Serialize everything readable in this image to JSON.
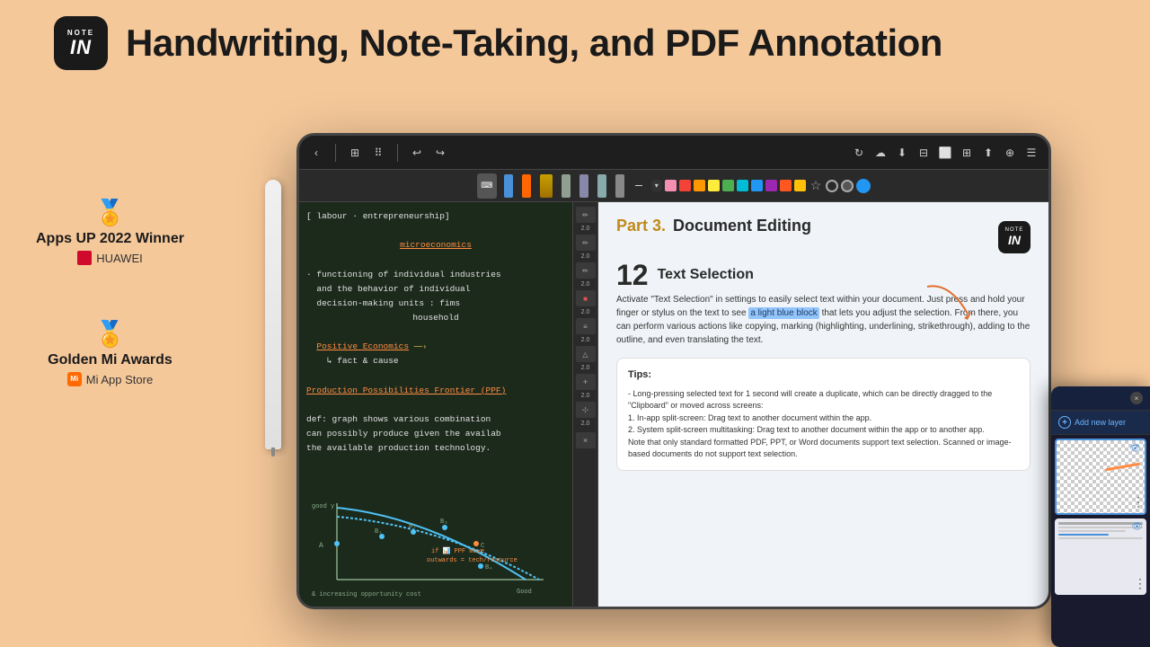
{
  "header": {
    "logo_note": "NOTE",
    "logo_in": "IN",
    "title": "Handwriting, Note-Taking, and PDF Annotation"
  },
  "awards": [
    {
      "id": "apps_up",
      "title": "Apps UP 2022 Winner",
      "brand": "HUAWEI"
    },
    {
      "id": "golden_mi",
      "title": "Golden Mi Awards",
      "brand": "Mi App Store"
    }
  ],
  "tablet": {
    "toolbar_icons": [
      "←",
      "☰",
      "⊞",
      "↩",
      "↪"
    ],
    "toolbar_right_icons": [
      "↻",
      "☁",
      "⬇",
      "⊟",
      "⬜",
      "⊞",
      "⬆",
      "⊕",
      "☰"
    ]
  },
  "note_panel": {
    "lines": [
      "[ labour · entrepreneurship]",
      "",
      "microeconomics",
      "",
      "· functioning of individual industries",
      "  and the behavior of individual",
      "  decision-making units : fims",
      "  household",
      "",
      "Positive Economics",
      "↳ fact & cause",
      "",
      "Production Possibilities Frontier (PPF)",
      "",
      "def: graph shows various combination",
      "can possibly produce given the availab",
      "the available production technology.",
      "",
      "& increasing opportunity cost"
    ]
  },
  "doc_panel": {
    "part_label": "Part 3.",
    "part_title": "Document Editing",
    "section_num": "12",
    "section_title": "Text Selection",
    "body_text": "Activate \"Text Selection\" in settings to easily select text within your document. Just press and hold your finger or stylus on the text to see",
    "highlight_text": "a light blue block",
    "body_text2": "that lets you adjust the selection. From there, you can perform various actions like copying, marking (highlighting, underlining, strikethrough), adding to the outline, and even translating the text.",
    "tips_title": "Tips:",
    "tips_lines": [
      "- Long-pressing selected text for 1 second will create a duplicate, which can be directly dragged to the \"Clipboard\" or moved across screens:",
      "1. In-app split-screen: Drag text to another document within the app.",
      "2. System split-screen multitasking: Drag text to another document within the app or to another app.",
      "Note that only standard formatted PDF, PPT, or Word documents support text selection. Scanned or image-based documents do not support text selection."
    ]
  },
  "layer_panel": {
    "close_label": "×",
    "add_layer_label": "Add new layer",
    "layers": [
      {
        "id": "layer1",
        "active": true
      },
      {
        "id": "layer2",
        "active": false
      }
    ]
  },
  "colors": {
    "bg": "#f5c89a",
    "tablet_bg": "#2a2a2a",
    "note_bg": "#1c2a1c",
    "doc_bg": "#f0f4f8",
    "orange_accent": "#ff8c42",
    "blue_accent": "#4a90d9",
    "award_gold": "#c8a055"
  }
}
